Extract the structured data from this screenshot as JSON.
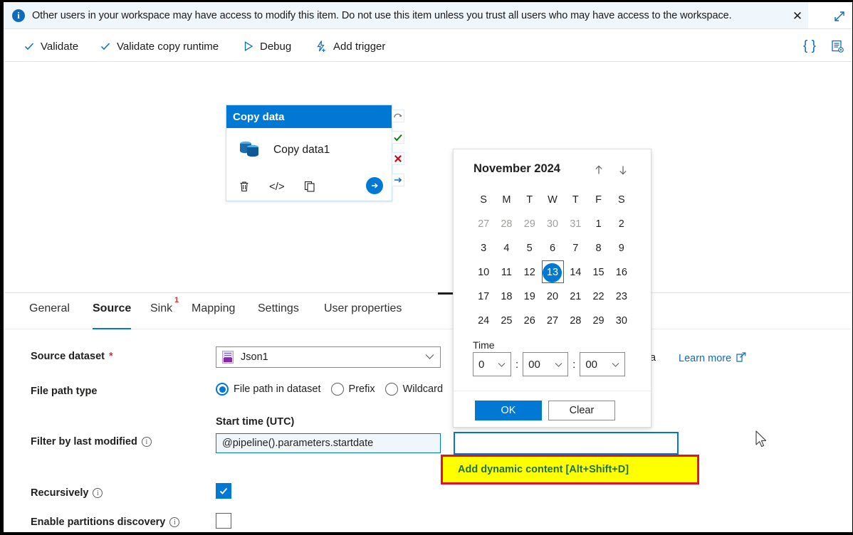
{
  "banner": {
    "icon": "info-icon",
    "message": "Other users in your workspace may have access to modify this item. Do not use this item unless you trust all users who may have access to the workspace.",
    "close_label": "✕",
    "expand_icon": "expand-diagonal-icon"
  },
  "toolbar": {
    "items": [
      {
        "label": "Validate",
        "icon": "checkmark-icon"
      },
      {
        "label": "Validate copy runtime",
        "icon": "checkmark-icon"
      },
      {
        "label": "Debug",
        "icon": "play-triangle-icon"
      },
      {
        "label": "Add trigger",
        "icon": "lightning-bolt-plus-icon"
      }
    ],
    "right_icons": [
      {
        "name": "code-braces-icon",
        "glyph": "{ }"
      },
      {
        "name": "properties-gear-icon",
        "glyph": ""
      }
    ]
  },
  "canvas": {
    "activity": {
      "header_title": "Copy data",
      "name": "Copy data1",
      "icons": [
        {
          "name": "delete-icon",
          "glyph": "🗑"
        },
        {
          "name": "code-icon",
          "glyph": "</>"
        },
        {
          "name": "clone-icon",
          "glyph": "⧉"
        }
      ],
      "go_icon": "arrow-right-icon",
      "connectors": [
        {
          "name": "skip-connector",
          "glyph": "↷"
        },
        {
          "name": "success-connector",
          "glyph": "✔"
        },
        {
          "name": "failure-connector",
          "glyph": "✖"
        },
        {
          "name": "completion-connector",
          "glyph": "→"
        }
      ],
      "status_marker": "red-circle-indicator"
    }
  },
  "tabs": [
    {
      "label": "General",
      "active": false,
      "badge": ""
    },
    {
      "label": "Source",
      "active": true,
      "badge": ""
    },
    {
      "label": "Sink",
      "active": false,
      "badge": "1"
    },
    {
      "label": "Mapping",
      "active": false,
      "badge": ""
    },
    {
      "label": "Settings",
      "active": false,
      "badge": ""
    },
    {
      "label": "User properties",
      "active": false,
      "badge": ""
    }
  ],
  "form": {
    "source_dataset": {
      "label": "Source dataset",
      "required_marker": "*",
      "value": "Json1",
      "icon": "json-dataset-icon"
    },
    "file_path_type": {
      "label": "File path type",
      "options": [
        {
          "label": "File path in dataset",
          "selected": true
        },
        {
          "label": "Prefix",
          "selected": false
        },
        {
          "label": "Wildcard",
          "selected": false
        }
      ]
    },
    "filter_by_last_modified": {
      "label": "Filter by last modified",
      "info": "ⓘ",
      "start_time_label": "Start time (UTC)",
      "start_time_value": "@pipeline().parameters.startdate",
      "end_time_value": ""
    },
    "recursively": {
      "label": "Recursively",
      "checked": true
    },
    "enable_partitions_discovery": {
      "label": "Enable partitions discovery",
      "checked": false
    },
    "learn_more": {
      "label": "Learn more",
      "icon": "external-link-icon"
    },
    "stray_text": "a"
  },
  "calendar": {
    "title": "November 2024",
    "prev_icon": "arrow-up-icon",
    "next_icon": "arrow-down-icon",
    "weekdays": [
      "S",
      "M",
      "T",
      "W",
      "T",
      "F",
      "S"
    ],
    "weeks": [
      [
        {
          "d": "27",
          "out": true
        },
        {
          "d": "28",
          "out": true
        },
        {
          "d": "29",
          "out": true
        },
        {
          "d": "30",
          "out": true
        },
        {
          "d": "31",
          "out": true
        },
        {
          "d": "1",
          "out": false
        },
        {
          "d": "2",
          "out": false
        }
      ],
      [
        {
          "d": "3",
          "out": false
        },
        {
          "d": "4",
          "out": false
        },
        {
          "d": "5",
          "out": false
        },
        {
          "d": "6",
          "out": false
        },
        {
          "d": "7",
          "out": false
        },
        {
          "d": "8",
          "out": false
        },
        {
          "d": "9",
          "out": false
        }
      ],
      [
        {
          "d": "10",
          "out": false
        },
        {
          "d": "11",
          "out": false
        },
        {
          "d": "12",
          "out": false
        },
        {
          "d": "13",
          "out": false,
          "selected": true
        },
        {
          "d": "14",
          "out": false
        },
        {
          "d": "15",
          "out": false
        },
        {
          "d": "16",
          "out": false
        }
      ],
      [
        {
          "d": "17",
          "out": false
        },
        {
          "d": "18",
          "out": false
        },
        {
          "d": "19",
          "out": false
        },
        {
          "d": "20",
          "out": false
        },
        {
          "d": "21",
          "out": false
        },
        {
          "d": "22",
          "out": false
        },
        {
          "d": "23",
          "out": false
        }
      ],
      [
        {
          "d": "24",
          "out": false
        },
        {
          "d": "25",
          "out": false
        },
        {
          "d": "26",
          "out": false
        },
        {
          "d": "27",
          "out": false
        },
        {
          "d": "28",
          "out": false
        },
        {
          "d": "29",
          "out": false
        },
        {
          "d": "30",
          "out": false
        }
      ]
    ],
    "selected_day": "13",
    "time_label": "Time",
    "time": {
      "hours": "0",
      "minutes": "00",
      "seconds": "00",
      "separator": ":"
    },
    "ok_label": "OK",
    "clear_label": "Clear"
  },
  "tooltip": {
    "text": "Add dynamic content [Alt+Shift+D]",
    "background": "#ffff00",
    "border": "#e81123",
    "text_color": "#1e7145"
  },
  "colors": {
    "accent": "#0078d4",
    "banner_bg": "#eff6fc",
    "link": "#0f6cbd",
    "danger": "#d13438",
    "success": "#107c10"
  }
}
